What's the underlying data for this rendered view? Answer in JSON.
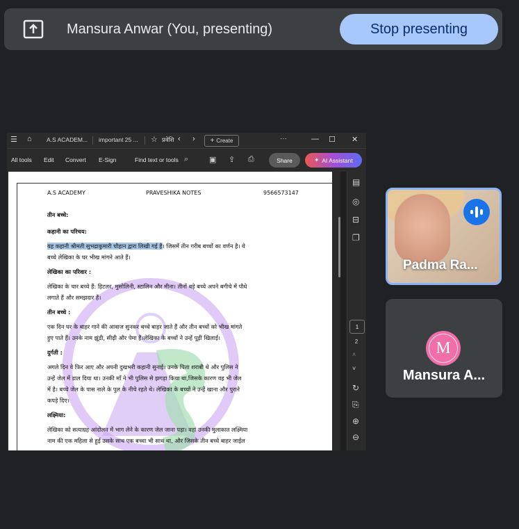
{
  "presenting_bar": {
    "presenter_text": "Mansura Anwar (You, presenting)",
    "stop_label": "Stop presenting"
  },
  "browser": {
    "tabs": [
      {
        "label": "A.S ACADEM..."
      },
      {
        "label": "important 25 ..."
      },
      {
        "label": "प्रवेशि"
      }
    ],
    "create_label": "Create",
    "more_label": "···"
  },
  "toolbar": {
    "all_tools": "All tools",
    "edit": "Edit",
    "convert": "Convert",
    "esign": "E-Sign",
    "find": "Find text or tools",
    "share": "Share",
    "ai": "AI Assistant"
  },
  "document": {
    "header_left": "A.S ACADEMY",
    "header_center": "PRAVESHIKA NOTES",
    "header_right": "9566573147",
    "watermark_text": "A.S ACADEMY",
    "lines": [
      {
        "text": "तीन बच्चे:",
        "bold": true
      },
      {
        "text": "कहानी का परिचय:",
        "bold": true
      },
      {
        "highlight": "यह कहानी श्रीमती सुभद्राकुमारी चौहान द्वारा लिखी गई है",
        "text": "। जिसमें तीन गरीब बच्चों का वर्णन है। ये"
      },
      {
        "text": "बच्चे लेखिका के घर भीख मांगने आते हैं।"
      },
      {
        "text": "लेखिका का परिवार :",
        "bold": true
      },
      {
        "text": "लेखिका के चार बच्चे हैं: हिटलर, मुसोलिनी, स्टालिन और मीना। तीनों बड़े बच्चे अपने बगीचे में पौधे"
      },
      {
        "text": "लगाते हैं और समझदार हैं।"
      },
      {
        "text": "तीन बच्चे :",
        "bold": true
      },
      {
        "text": "एक दिन घर के बाहर गाने की आवाज सुनकर बच्चे बाहर जाते हैं और तीन बच्चों को भीख मांगते"
      },
      {
        "text": "हुए पाते हैं। उनके नाम झूंडी, सीढ़ी और पेमा हैं।लेखिका के बच्चों ने उन्हें पूड़ी खिलाई।"
      },
      {
        "text": "दुर्गती :",
        "bold": true
      },
      {
        "text": "अगले दिन वे फिर आए और अपनी दुखभरी कहानी सुनाई। उनके पिता शराबी थे और पुलिस ने"
      },
      {
        "text": "उन्हें जेल में डाल दिया था। उनकी माँ ने भी पुलिस से झगड़ा किया था,जिसके कारण वह भी जेल"
      },
      {
        "text": "में है। बच्चे जेल के पास नाले के पुल के नीचे रहते थे। लेखिका के बच्चों ने उन्हें खाना और पुराने"
      },
      {
        "text": "कपड़े दिए।"
      },
      {
        "text": "लक्ष्मिया:",
        "bold": true
      },
      {
        "text": "लेखिका को सत्याग्रह आंदोलन में भाग लेने के कारण जेल जाना पड़ा। वहां उनकी मुलाकात लक्ष्मिया"
      },
      {
        "text": "नाम की एक महिला से हुई उसके साथ एक बच्चा भी साथ था, और  जिसके तीन बच्चे बाहर जाईल"
      }
    ]
  },
  "pager": {
    "current": "1",
    "next": "2"
  },
  "participants": [
    {
      "name": "Padma Ra...",
      "speaking": true,
      "accent": "#8ab4f8"
    },
    {
      "name": "Mansura A...",
      "avatar_letter": "M",
      "avatar_color": "#f06fa8"
    }
  ]
}
